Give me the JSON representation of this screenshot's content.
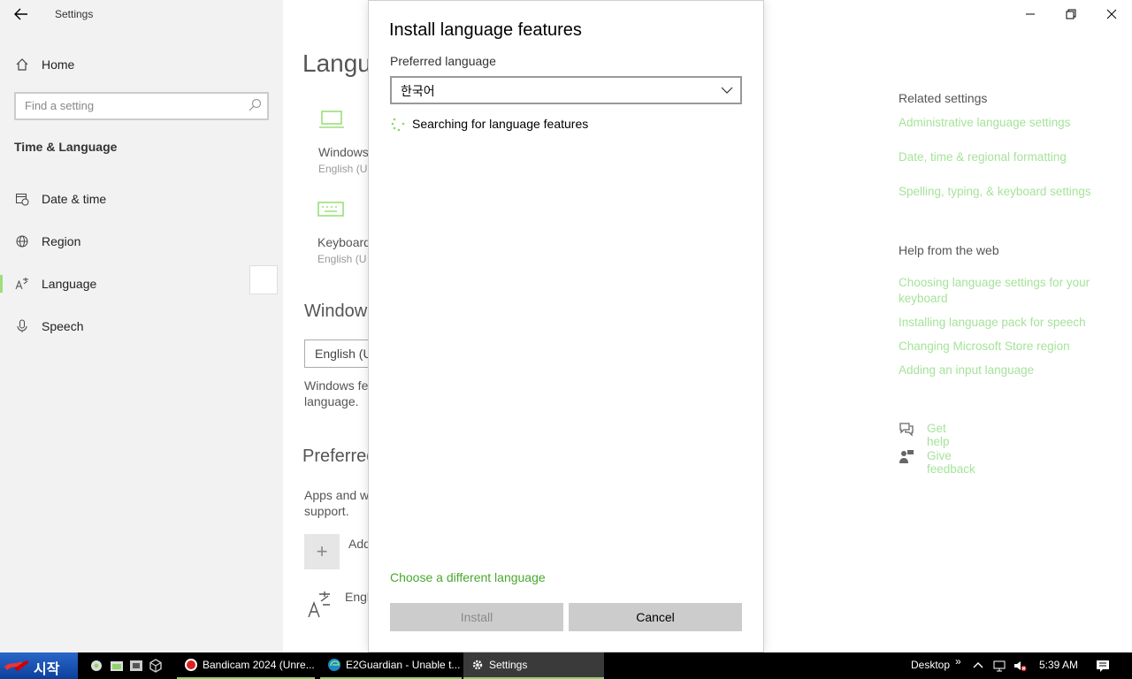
{
  "app": {
    "title": "Settings"
  },
  "nav": {
    "home": "Home",
    "search_placeholder": "Find a setting",
    "section": "Time & Language",
    "items": [
      {
        "label": "Date & time",
        "icon": "calendar-clock-icon"
      },
      {
        "label": "Region",
        "icon": "globe-icon"
      },
      {
        "label": "Language",
        "icon": "language-icon",
        "active": true
      },
      {
        "label": "Speech",
        "icon": "microphone-icon"
      }
    ]
  },
  "main": {
    "title": "Langu",
    "tile1": {
      "label": "Windows",
      "sub": "English (U"
    },
    "tile2": {
      "label": "Keyboard",
      "sub": "English (U"
    },
    "section1": "Window",
    "dropdown_value": "English (U",
    "section1_text": [
      "Windows fe",
      "language."
    ],
    "section2": "Preferred",
    "section2_text": [
      "Apps and w",
      "support."
    ],
    "add_label": "Add",
    "lang_label": "Engl"
  },
  "related": {
    "heading": "Related settings",
    "links": [
      "Administrative language settings",
      "Date, time & regional formatting",
      "Spelling, typing, & keyboard settings"
    ],
    "help_heading": "Help from the web",
    "help_links": [
      "Choosing language settings for your keyboard",
      "Installing language pack for speech",
      "Changing Microsoft Store region",
      "Adding an input language"
    ],
    "get_help": "Get help",
    "give_feedback": "Give feedback"
  },
  "dialog": {
    "title": "Install language features",
    "preferred_label": "Preferred language",
    "preferred_value": "한국어",
    "status": "Searching for language features",
    "choose_link": "Choose a different language",
    "install": "Install",
    "cancel": "Cancel"
  },
  "taskbar": {
    "start": "시작",
    "tasks": [
      {
        "label": "Bandicam 2024 (Unre...",
        "icon": "bandicam-icon"
      },
      {
        "label": "E2Guardian - Unable t...",
        "icon": "edge-icon"
      },
      {
        "label": "Settings",
        "icon": "gear-icon"
      }
    ],
    "desktop": "Desktop",
    "time": "5:39 AM"
  },
  "colors": {
    "accent_link": "#a6e39a",
    "dialog_link": "#4aa72d",
    "active_bar": "#9be07a"
  }
}
